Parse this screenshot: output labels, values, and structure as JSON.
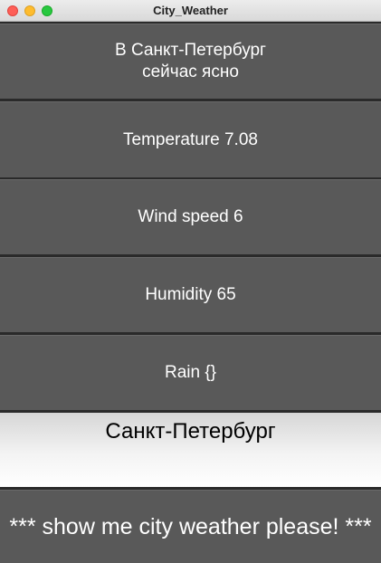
{
  "window": {
    "title": "City_Weather"
  },
  "weather": {
    "status_line1": "В Санкт-Петербург",
    "status_line2": "сейчас ясно",
    "temperature": "Temperature 7.08",
    "wind": "Wind speed 6",
    "humidity": "Humidity 65",
    "rain": "Rain {}"
  },
  "input": {
    "city_value": "Санкт-Петербург"
  },
  "action": {
    "label": "*** show me city weather please! ***"
  },
  "colors": {
    "tile_background": "#595959",
    "tile_text": "#ffffff",
    "input_background": "#ffffff",
    "separator": "#1e1e1e"
  }
}
